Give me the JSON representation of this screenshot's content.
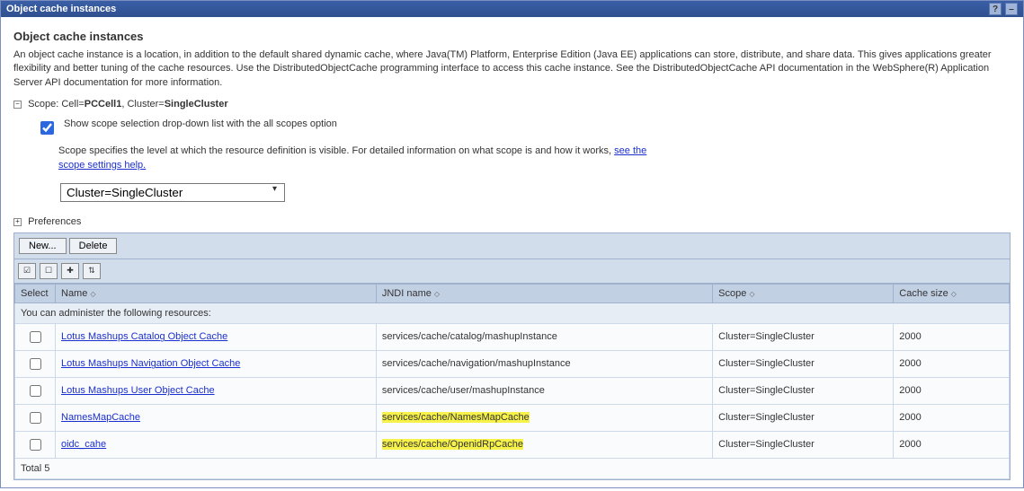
{
  "window": {
    "title": "Object cache instances"
  },
  "page": {
    "heading": "Object cache instances",
    "description": "An object cache instance is a location, in addition to the default shared dynamic cache, where Java(TM) Platform, Enterprise Edition (Java EE) applications can store, distribute, and share data. This gives applications greater flexibility and better tuning of the cache resources. Use the DistributedObjectCache programming interface to access this cache instance. See the DistributedObjectCache API documentation in the WebSphere(R) Application Server API documentation for more information."
  },
  "scope": {
    "label_prefix": "Scope: Cell=",
    "cell": "PCCell1",
    "cluster_label": ", Cluster=",
    "cluster": "SingleCluster",
    "checkbox_label": "Show scope selection drop-down list with the all scopes option",
    "help_text": "Scope specifies the level at which the resource definition is visible. For detailed information on what scope is and how it works, ",
    "help_link": "see the scope settings help.",
    "selected": "Cluster=SingleCluster"
  },
  "preferences": {
    "label": "Preferences"
  },
  "toolbar": {
    "new": "New...",
    "delete": "Delete"
  },
  "columns": {
    "select": "Select",
    "name": "Name",
    "jndi": "JNDI name",
    "scope": "Scope",
    "size": "Cache size"
  },
  "subhead": "You can administer the following resources:",
  "rows": [
    {
      "name": "Lotus Mashups Catalog Object Cache",
      "jndi": "services/cache/catalog/mashupInstance",
      "scope": "Cluster=SingleCluster",
      "size": "2000",
      "hl": false
    },
    {
      "name": "Lotus Mashups Navigation Object Cache",
      "jndi": "services/cache/navigation/mashupInstance",
      "scope": "Cluster=SingleCluster",
      "size": "2000",
      "hl": false
    },
    {
      "name": "Lotus Mashups User Object Cache",
      "jndi": "services/cache/user/mashupInstance",
      "scope": "Cluster=SingleCluster",
      "size": "2000",
      "hl": false
    },
    {
      "name": "NamesMapCache",
      "jndi": "services/cache/NamesMapCache",
      "scope": "Cluster=SingleCluster",
      "size": "2000",
      "hl": true
    },
    {
      "name": "oidc_cahe",
      "jndi": "services/cache/OpenidRpCache",
      "scope": "Cluster=SingleCluster",
      "size": "2000",
      "hl": true
    }
  ],
  "footer": "Total 5"
}
